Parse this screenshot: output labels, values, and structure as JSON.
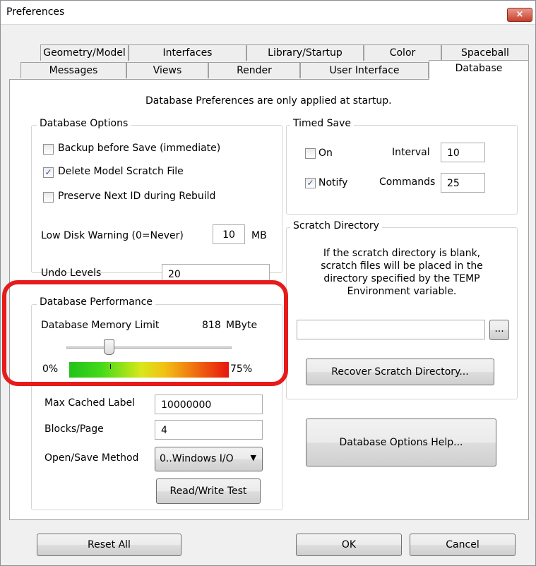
{
  "window": {
    "title": "Preferences",
    "close_glyph": "×"
  },
  "tabs_row1": [
    "Geometry/Model",
    "Interfaces",
    "Library/Startup",
    "Color",
    "Spaceball"
  ],
  "tabs_row2": [
    "Messages",
    "Views",
    "Render",
    "User Interface",
    "Database"
  ],
  "active_tab": "Database",
  "panel": {
    "note": "Database Preferences are only applied at startup.",
    "db_options": {
      "title": "Database Options",
      "backup_label": "Backup before Save (immediate)",
      "backup_checked": false,
      "delete_scratch_label": "Delete Model Scratch File",
      "delete_scratch_checked": true,
      "preserve_id_label": "Preserve Next ID during Rebuild",
      "preserve_id_checked": false,
      "low_disk_label": "Low Disk Warning (0=Never)",
      "low_disk_value": "10",
      "low_disk_unit": "MB",
      "undo_label": "Undo Levels",
      "undo_value": "20"
    },
    "timed_save": {
      "title": "Timed Save",
      "on_label": "On",
      "on_checked": false,
      "notify_label": "Notify",
      "notify_checked": true,
      "interval_label": "Interval",
      "interval_value": "10",
      "commands_label": "Commands",
      "commands_value": "25"
    },
    "scratch": {
      "title": "Scratch Directory",
      "description_lines": [
        "If the scratch directory is blank,",
        "scratch files will be placed in the",
        "directory specified by the TEMP",
        "Environment variable."
      ],
      "path_value": "",
      "browse_label": "...",
      "recover_label": "Recover Scratch Directory..."
    },
    "performance": {
      "title": "Database Performance",
      "memory_label": "Database Memory Limit",
      "memory_value": "818",
      "memory_unit": "MByte",
      "slider_fraction": 0.26,
      "min_label": "0%",
      "max_label": "75%"
    },
    "cache": {
      "max_cached_label": "Max Cached Label",
      "max_cached_value": "10000000",
      "blocks_label": "Blocks/Page",
      "blocks_value": "4",
      "open_save_label": "Open/Save Method",
      "open_save_value": "0..Windows I/O",
      "rw_test_label": "Read/Write Test"
    },
    "help_label": "Database Options Help..."
  },
  "footer": {
    "reset_label": "Reset All",
    "ok_label": "OK",
    "cancel_label": "Cancel"
  },
  "colors": {
    "highlight": "#e61b1b",
    "checkmark": "#2a55a5"
  },
  "icons": {
    "checkbox_checked": "check-icon",
    "dropdown": "chevron-down-icon"
  }
}
